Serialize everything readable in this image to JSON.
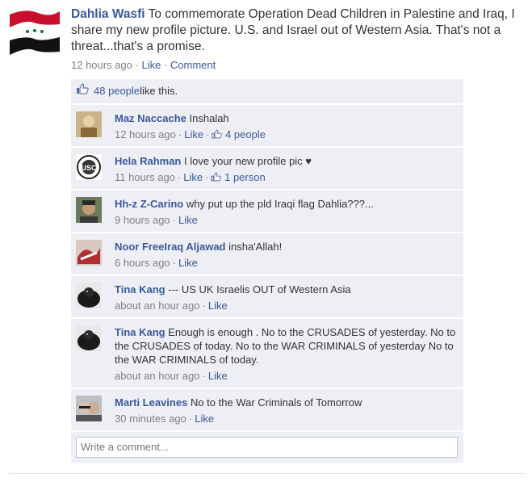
{
  "post": {
    "author": "Dahlia Wasfi",
    "text": "To commemorate Operation Dead Children in Palestine and Iraq, I share my new profile picture. U.S. and Israel out of Western Asia. That's not a threat...that's a promise.",
    "time": "12 hours ago",
    "sep1": " · ",
    "like": "Like",
    "sep2": " · ",
    "comment": "Comment"
  },
  "likes": {
    "text": "48 people",
    "suffix": " like this."
  },
  "comments": [
    {
      "name": "Maz Naccache",
      "text": "Inshalah",
      "time": "12 hours ago",
      "like": "Like",
      "likes": "4 people"
    },
    {
      "name": "Hela Rahman",
      "text": "I love your new profile pic ♥",
      "time": "11 hours ago",
      "like": "Like",
      "likes": "1 person"
    },
    {
      "name": "Hh-z Z-Carino",
      "text": "why put up the pld Iraqi flag Dahlia???...",
      "time": "9 hours ago",
      "like": "Like"
    },
    {
      "name": "Noor FreeIraq Aljawad",
      "text": "insha'Allah!",
      "time": "6 hours ago",
      "like": "Like"
    },
    {
      "name": "Tina Kang",
      "text": "--- US UK Israelis OUT of Western Asia",
      "time": "about an hour ago",
      "like": "Like"
    },
    {
      "name": "Tina Kang",
      "text": "Enough is enough . No to the CRUSADES of yesterday. No to the CRUSADES of today. No to the WAR CRIMINALS of yesterday No to the WAR CRIMINALS of today.",
      "time": "about an hour ago",
      "like": "Like"
    },
    {
      "name": "Marti Leavines",
      "text": "No to the War Criminals of Tomorrow",
      "time": "30 minutes ago",
      "like": "Like"
    }
  ],
  "write": {
    "placeholder": "Write a comment..."
  },
  "avatar_labels": {
    "hela": "USC"
  }
}
